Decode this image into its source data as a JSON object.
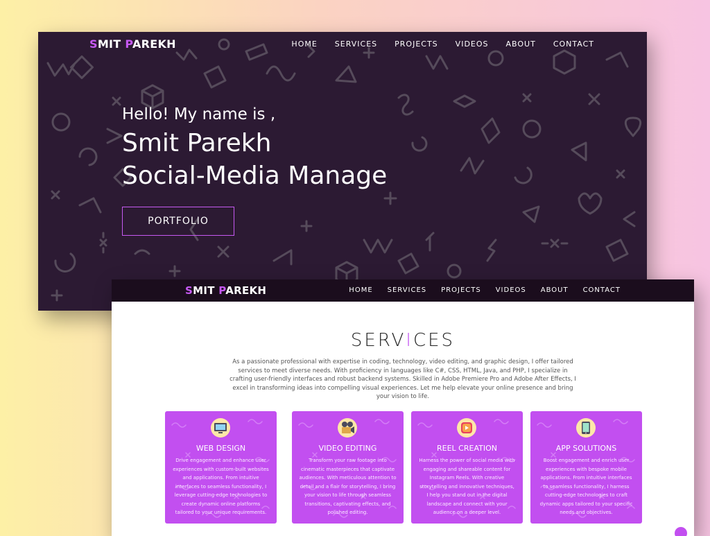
{
  "accent_color": "#c659f2",
  "hero_bg_color": "#2c1a33",
  "brand": {
    "initial1": "S",
    "rest1": "MIT ",
    "initial2": "P",
    "rest2": "AREKH"
  },
  "nav": {
    "items": [
      "HOME",
      "SERVICES",
      "PROJECTS",
      "VIDEOS",
      "ABOUT",
      "CONTACT"
    ]
  },
  "hero": {
    "greeting": "Hello! My name is ,",
    "name": "Smit Parekh",
    "role": "Social-Media Manage",
    "button_label": "PORTFOLIO"
  },
  "services": {
    "title_a": "SERV",
    "title_b": "I",
    "title_c": "CES",
    "description": "As a passionate professional with expertise in coding, technology, video editing, and graphic design, I offer tailored services to meet diverse needs. With proficiency in languages like C#, CSS, HTML, Java, and PHP, I specialize in crafting user-friendly interfaces and robust backend systems. Skilled in Adobe Premiere Pro and Adobe After Effects, I excel in transforming ideas into compelling visual experiences. Let me help elevate your online presence and bring your vision to life.",
    "cards": [
      {
        "icon": "web-design-icon",
        "title": "WEB DESIGN",
        "text": "Drive engagement and enhance user experiences with custom-built websites and applications. From intuitive interfaces to seamless functionality, I leverage cutting-edge technologies to create dynamic online platforms tailored to your unique requirements."
      },
      {
        "icon": "video-camera-icon",
        "title": "VIDEO EDITING",
        "text": "Transform your raw footage into cinematic masterpieces that captivate audiences. With meticulous attention to detail and a flair for storytelling, I bring your vision to life through seamless transitions, captivating effects, and polished editing."
      },
      {
        "icon": "instagram-reel-icon",
        "title": "REEL CREATION",
        "text": "Harness the power of social media with engaging and shareable content for Instagram Reels. With creative storytelling and innovative techniques, I help you stand out in the digital landscape and connect with your audience on a deeper level."
      },
      {
        "icon": "mobile-app-icon",
        "title": "APP SOLUTIONS",
        "text": "Boost engagement and enrich user experiences with bespoke mobile applications. From intuitive interfaces to seamless functionality, I harness cutting-edge technologies to craft dynamic apps tailored to your specific needs and objectives."
      }
    ]
  }
}
